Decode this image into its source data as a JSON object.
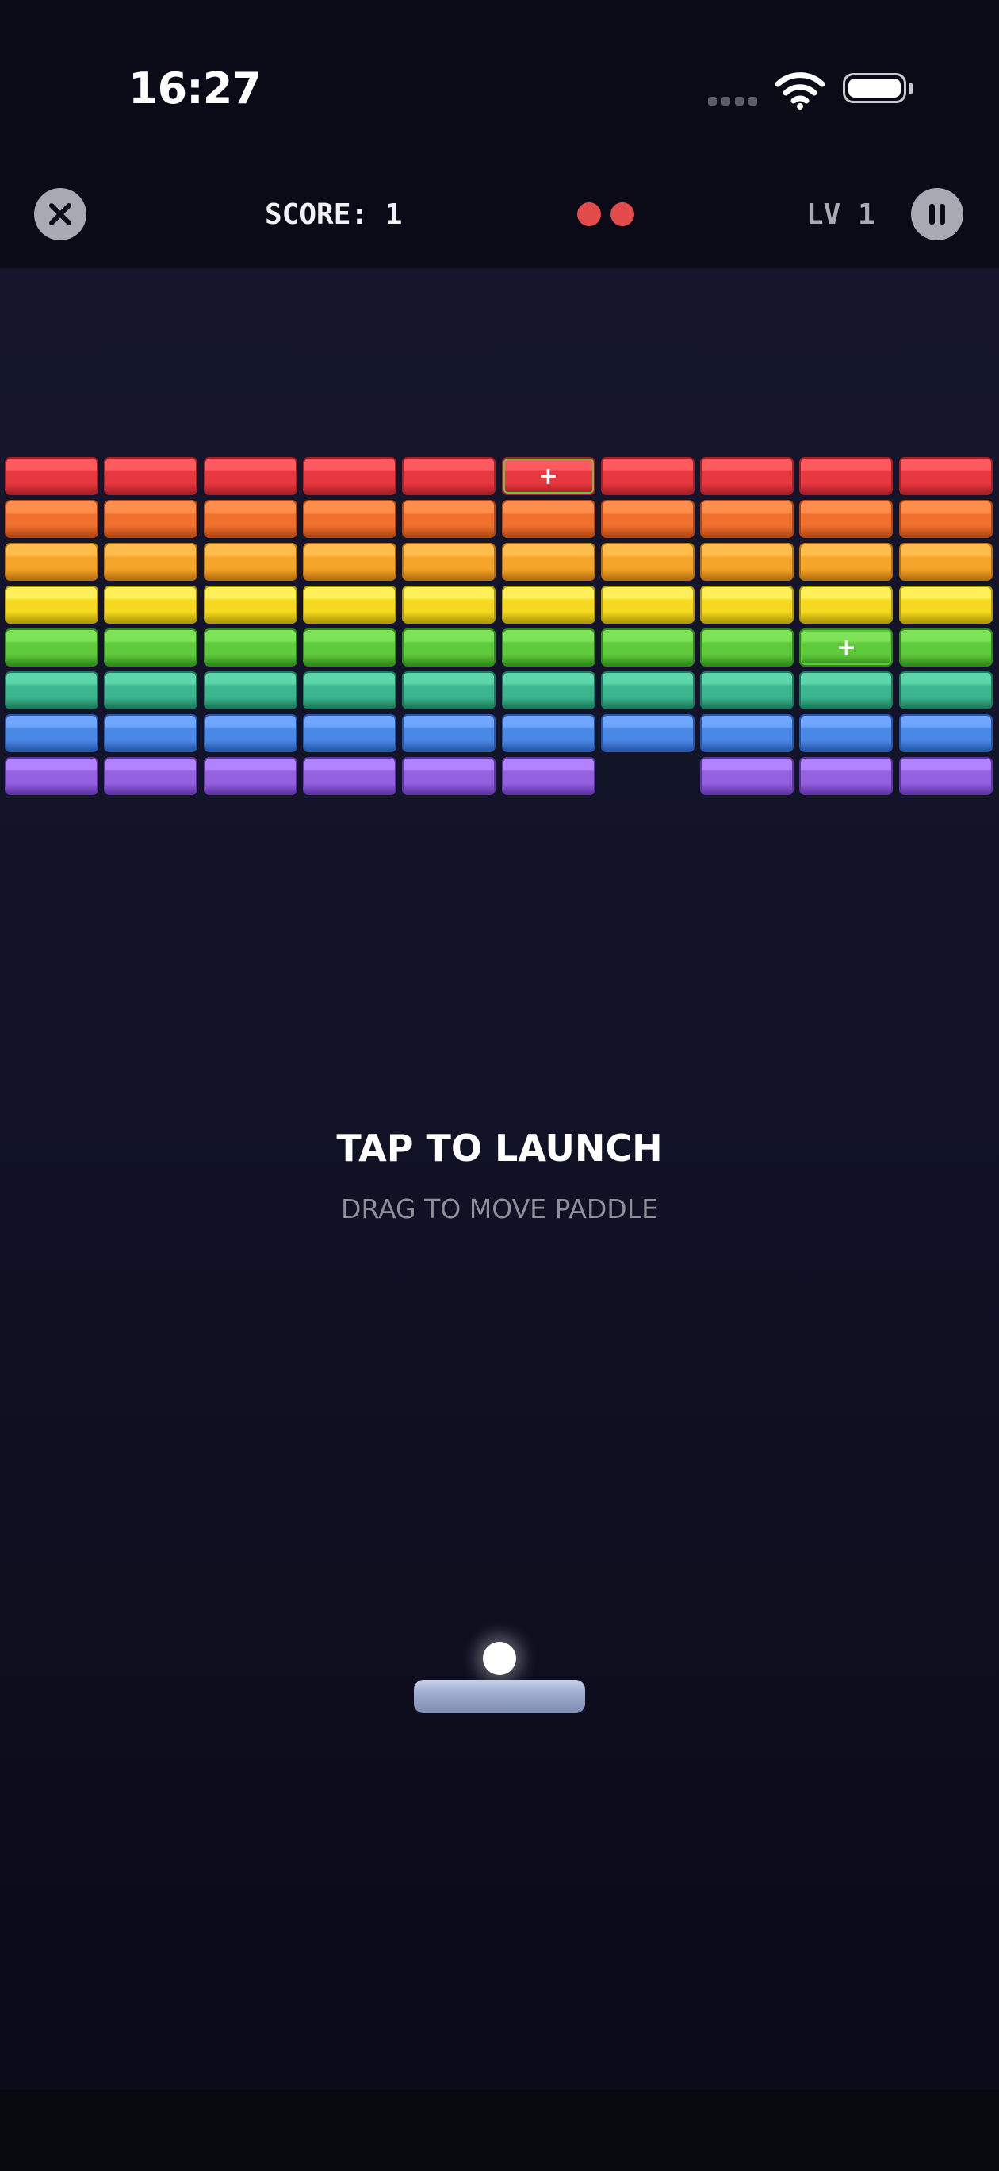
{
  "status_bar": {
    "time": "16:27",
    "signal_icon": "cellular-signal-icon",
    "wifi_icon": "wifi-icon",
    "battery_icon": "battery-icon",
    "battery_level": 1.0
  },
  "hud": {
    "close_icon": "close-icon",
    "score_label": "SCORE: 1",
    "lives_remaining": 2,
    "life_color": "#e34b4b",
    "level_label": "LV 1",
    "pause_icon": "pause-icon"
  },
  "bricks": {
    "columns": 10,
    "rows": [
      {
        "color": "red",
        "fill": "#e8383f",
        "top": "#ff5a60",
        "edge": "#a81f26",
        "present": [
          1,
          1,
          1,
          1,
          1,
          1,
          1,
          1,
          1,
          1
        ],
        "powerup_cols": [
          5
        ]
      },
      {
        "color": "orange",
        "fill": "#f0702e",
        "top": "#ff8d4e",
        "edge": "#b04712",
        "present": [
          1,
          1,
          1,
          1,
          1,
          1,
          1,
          1,
          1,
          1
        ],
        "powerup_cols": []
      },
      {
        "color": "amber",
        "fill": "#f5a52a",
        "top": "#ffbd4d",
        "edge": "#b66f0c",
        "present": [
          1,
          1,
          1,
          1,
          1,
          1,
          1,
          1,
          1,
          1
        ],
        "powerup_cols": []
      },
      {
        "color": "yellow",
        "fill": "#f5d820",
        "top": "#fff05a",
        "edge": "#b39a08",
        "present": [
          1,
          1,
          1,
          1,
          1,
          1,
          1,
          1,
          1,
          1
        ],
        "powerup_cols": []
      },
      {
        "color": "green",
        "fill": "#5fcb3c",
        "top": "#7fe35a",
        "edge": "#2f8a1a",
        "present": [
          1,
          1,
          1,
          1,
          1,
          1,
          1,
          1,
          1,
          1
        ],
        "powerup_cols": [
          8
        ]
      },
      {
        "color": "teal",
        "fill": "#3cb68e",
        "top": "#5dd6ac",
        "edge": "#1b7a5a",
        "present": [
          1,
          1,
          1,
          1,
          1,
          1,
          1,
          1,
          1,
          1
        ],
        "powerup_cols": []
      },
      {
        "color": "blue",
        "fill": "#4a88e6",
        "top": "#6fa6ff",
        "edge": "#2656a8",
        "present": [
          1,
          1,
          1,
          1,
          1,
          1,
          1,
          1,
          1,
          1
        ],
        "powerup_cols": []
      },
      {
        "color": "purple",
        "fill": "#9460e0",
        "top": "#b283ff",
        "edge": "#5f34a6",
        "present": [
          1,
          1,
          1,
          1,
          1,
          1,
          0,
          1,
          1,
          1
        ],
        "powerup_cols": []
      }
    ],
    "powerup_symbol": "+"
  },
  "prompt": {
    "title": "TAP TO LAUNCH",
    "subtitle": "DRAG TO MOVE PADDLE"
  },
  "game_objects": {
    "ball": "ball",
    "paddle": "paddle"
  }
}
